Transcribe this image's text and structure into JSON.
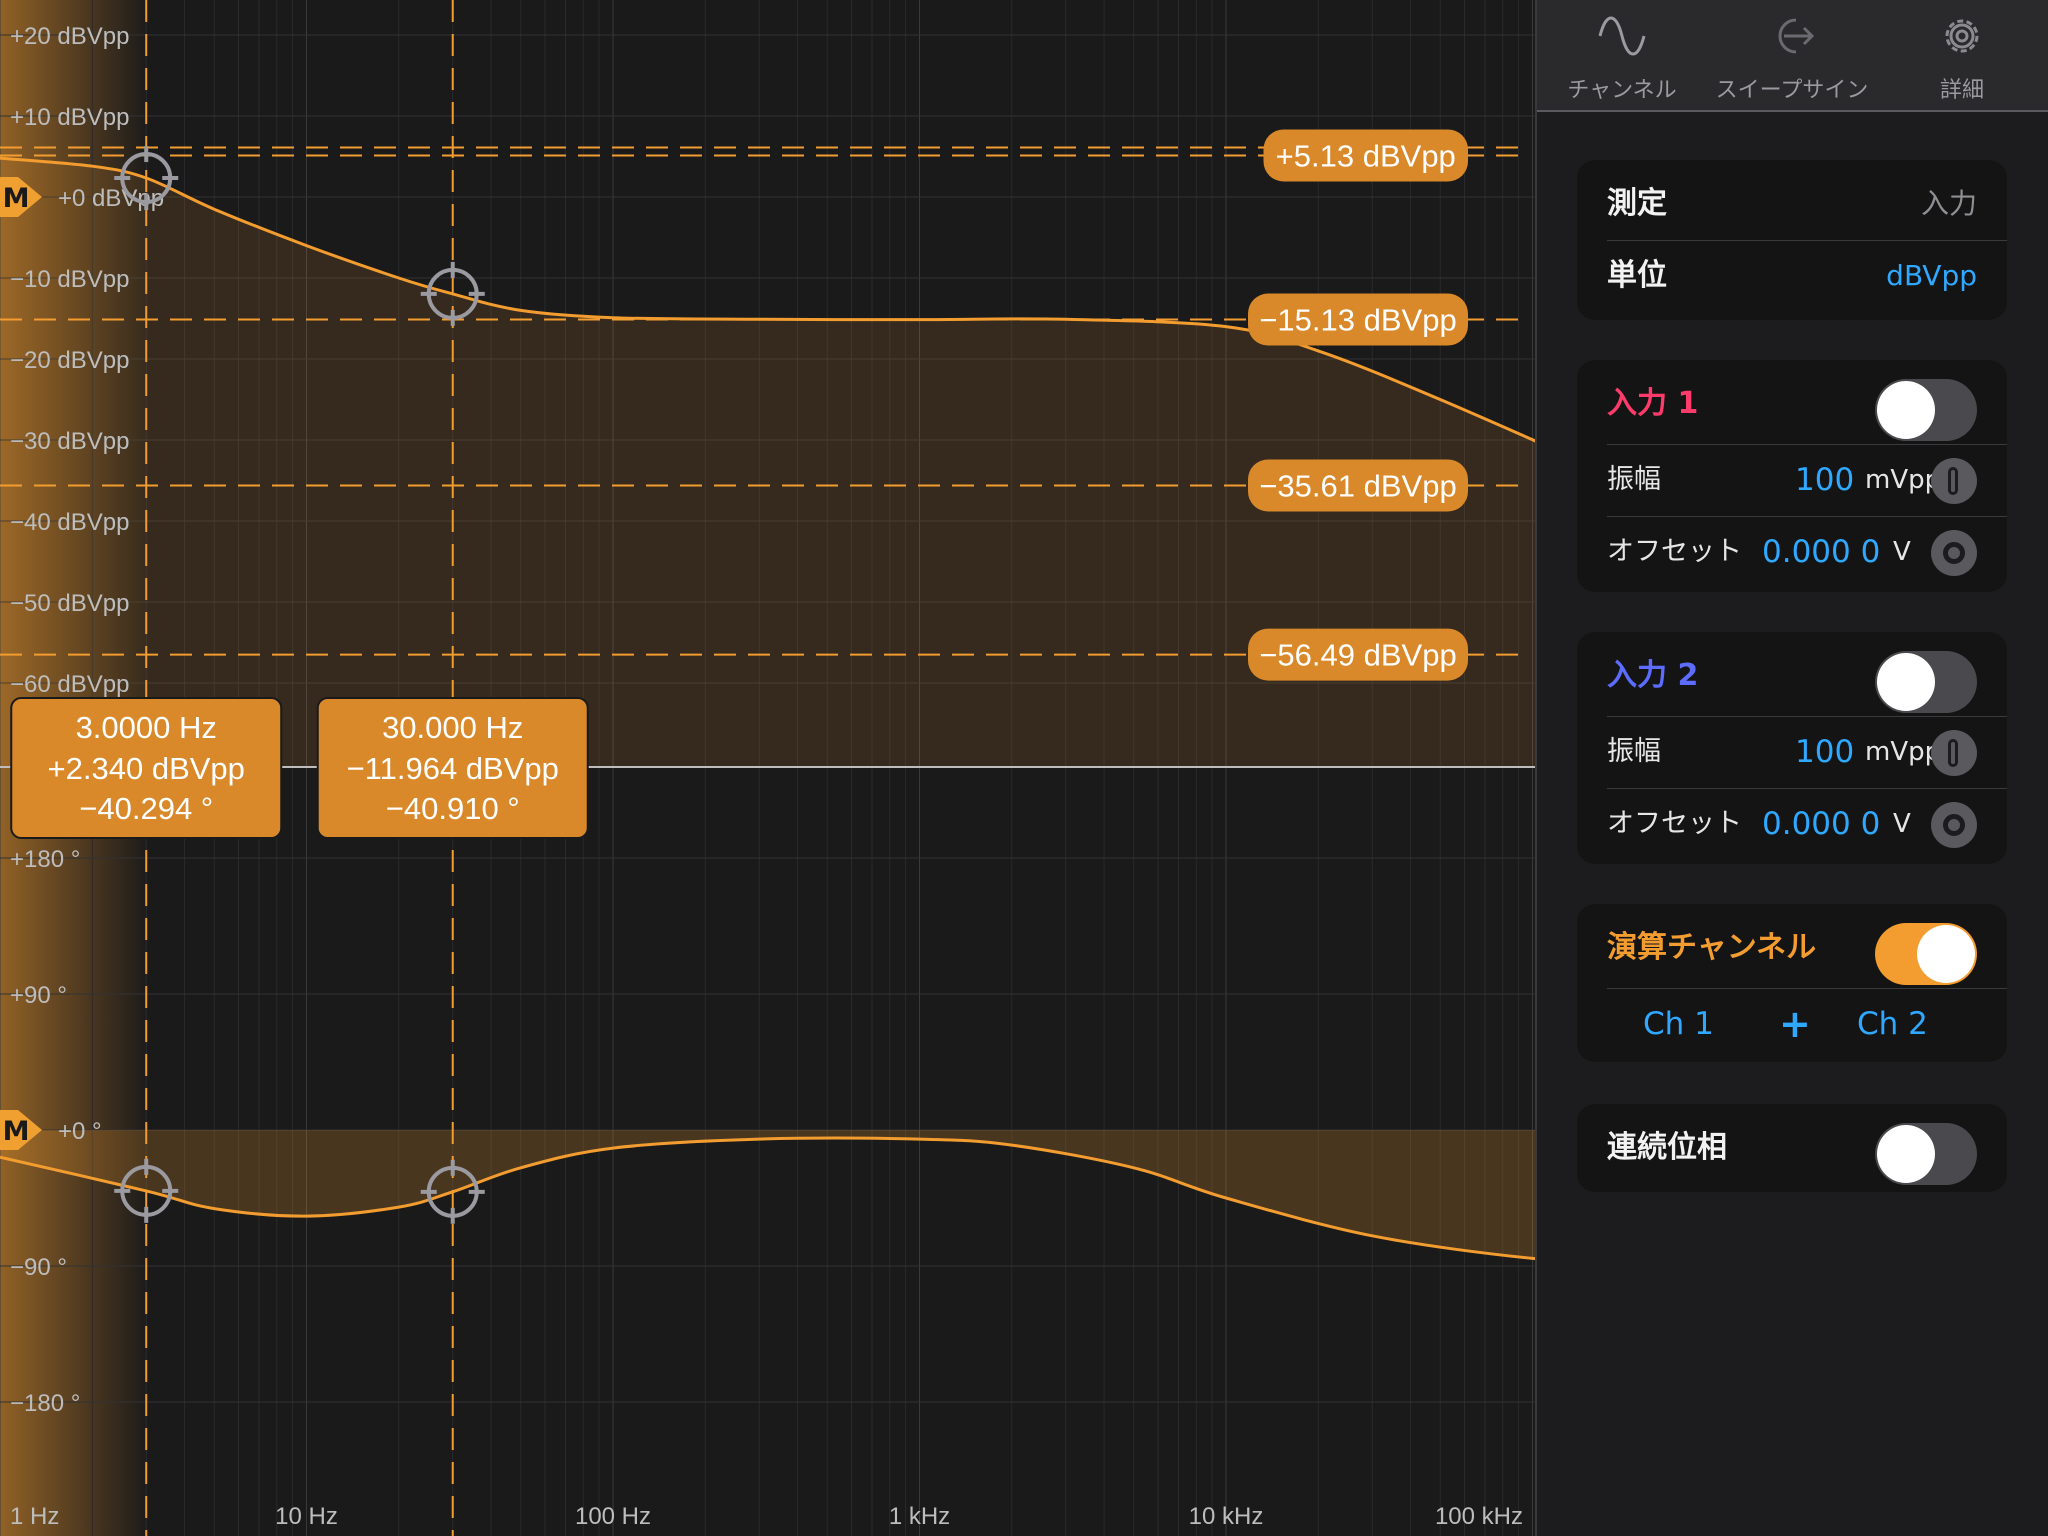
{
  "toolbar": {
    "items": [
      {
        "label": "チャンネル",
        "icon": "sine-wave-icon"
      },
      {
        "label": "スイープサイン",
        "icon": "export-arrow-icon"
      },
      {
        "label": "詳細",
        "icon": "gear-icon"
      }
    ]
  },
  "settings": {
    "measure": {
      "label": "測定",
      "value": "入力"
    },
    "unit": {
      "label": "単位",
      "value": "dBVpp"
    }
  },
  "input1": {
    "title": "入力 1",
    "title_color": "#ff3b6b",
    "enabled": false,
    "amplitude": {
      "label": "振幅",
      "value": "100",
      "unit": "mVpp"
    },
    "offset": {
      "label": "オフセット",
      "value": "0.000 0",
      "unit": "V"
    }
  },
  "input2": {
    "title": "入力 2",
    "title_color": "#5b6cff",
    "enabled": false,
    "amplitude": {
      "label": "振幅",
      "value": "100",
      "unit": "mVpp"
    },
    "offset": {
      "label": "オフセット",
      "value": "0.000 0",
      "unit": "V"
    }
  },
  "math": {
    "title": "演算チャンネル",
    "enabled": true,
    "operand_a": "Ch 1",
    "operator": "+",
    "operand_b": "Ch 2"
  },
  "phase": {
    "title": "連続位相",
    "enabled": false
  },
  "colors": {
    "accent": "#f39c2f",
    "blue": "#2fa8ff",
    "background": "#1a1a1b"
  },
  "chart_data": {
    "type": "line",
    "title": "",
    "x_scale": "log",
    "x_ticks": [
      "1 Hz",
      "10 Hz",
      "100 Hz",
      "1 kHz",
      "10 kHz",
      "100 kHz"
    ],
    "magnitude": {
      "y_ticks": [
        "+20 dBVpp",
        "+10 dBVpp",
        "+0 dBVpp",
        "−10 dBVpp",
        "−20 dBVpp",
        "−30 dBVpp",
        "−40 dBVpp",
        "−50 dBVpp",
        "−60 dBVpp"
      ],
      "ylim": [
        -70,
        25
      ],
      "marker_label": "M",
      "level_labels": [
        {
          "text": "+5.13 dBVpp",
          "value": 5.13
        },
        {
          "text": "−15.13 dBVpp",
          "value": -15.13
        },
        {
          "text": "−35.61 dBVpp",
          "value": -35.61
        },
        {
          "text": "−56.49 dBVpp",
          "value": -56.49
        }
      ],
      "series": {
        "x": [
          1,
          2,
          3,
          5,
          10,
          20,
          30,
          50,
          100,
          300,
          1000,
          3000,
          10000,
          20000,
          50000,
          200000
        ],
        "y": [
          4.8,
          3.8,
          2.34,
          -1.5,
          -6.0,
          -10.0,
          -11.964,
          -14.0,
          -14.9,
          -15.1,
          -15.13,
          -15.1,
          -16.0,
          -19.0,
          -25.0,
          -35.0
        ]
      }
    },
    "phase": {
      "y_ticks": [
        "+180 °",
        "+90 °",
        "+0 °",
        "−90 °",
        "−180 °"
      ],
      "ylim": [
        -200,
        215
      ],
      "marker_label": "M",
      "series": {
        "x": [
          1,
          3,
          5,
          10,
          20,
          30,
          50,
          100,
          300,
          1000,
          2000,
          5000,
          10000,
          30000,
          100000,
          200000
        ],
        "y": [
          -18,
          -40.294,
          -52,
          -57,
          -51,
          -40.91,
          -25,
          -12,
          -6,
          -6,
          -10,
          -25,
          -45,
          -70,
          -85,
          -87
        ]
      }
    },
    "cursors": [
      {
        "x_value": 3,
        "freq": "3.0000 Hz",
        "mag": "+2.340 dBVpp",
        "phase": "−40.294 °"
      },
      {
        "x_value": 30,
        "freq": "30.000 Hz",
        "mag": "−11.964 dBVpp",
        "phase": "−40.910 °"
      }
    ]
  }
}
